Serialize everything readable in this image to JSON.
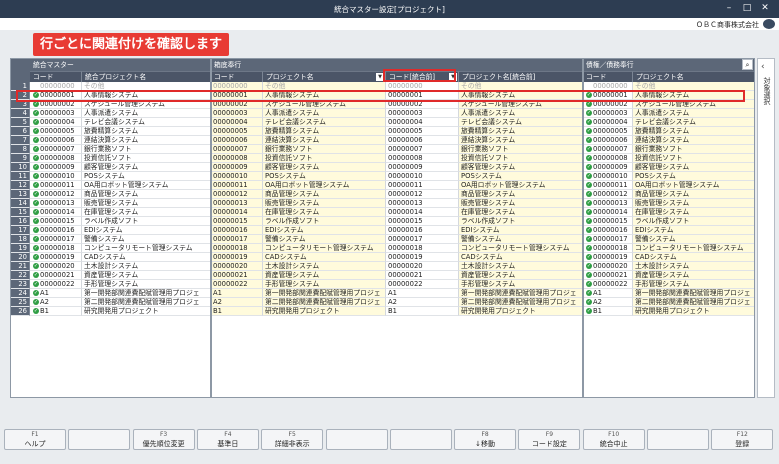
{
  "window": {
    "title": "統合マスター設定[プロジェクト]",
    "company": "ＯＢＣ商事株式会社"
  },
  "notice": "行ごとに関連付けを確認します",
  "groups": {
    "merged": "統合マスター",
    "left": "箱底奉行",
    "right": "債権／債務奉行"
  },
  "headers": {
    "code": "コード",
    "merged_name": "統合プロジェクト名",
    "project_name": "プロジェクト名",
    "code_merged": "コード[統合前]",
    "name_merged": "プロジェクト名[統合前]"
  },
  "side_panel": {
    "label": "対象選択"
  },
  "rows": [
    {
      "n": "1",
      "code": "00000000",
      "name": "その他",
      "lc": "00000000",
      "ln": "その他",
      "mc": "00000000",
      "mn": "その他",
      "rc": "00000000",
      "rn": "その他",
      "check": false,
      "placeholder": true
    },
    {
      "n": "2",
      "code": "00000001",
      "name": "人事情報システム",
      "lc": "00000001",
      "ln": "人事情報システム",
      "mc": "00000001",
      "mn": "人事情報システム",
      "rc": "00000001",
      "rn": "人事情報システム",
      "check": true
    },
    {
      "n": "3",
      "code": "00000002",
      "name": "スケジュール管理システム",
      "lc": "00000002",
      "ln": "スケジュール管理システム",
      "mc": "00000002",
      "mn": "スケジュール管理システム",
      "rc": "00000002",
      "rn": "スケジュール管理システム",
      "check": true
    },
    {
      "n": "4",
      "code": "00000003",
      "name": "人事派遣システム",
      "lc": "00000003",
      "ln": "人事派遣システム",
      "mc": "00000003",
      "mn": "人事派遣システム",
      "rc": "00000003",
      "rn": "人事派遣システム",
      "check": true
    },
    {
      "n": "5",
      "code": "00000004",
      "name": "テレビ会議システム",
      "lc": "00000004",
      "ln": "テレビ会議システム",
      "mc": "00000004",
      "mn": "テレビ会議システム",
      "rc": "00000004",
      "rn": "テレビ会議システム",
      "check": true
    },
    {
      "n": "6",
      "code": "00000005",
      "name": "旅費精算システム",
      "lc": "00000005",
      "ln": "旅費精算システム",
      "mc": "00000005",
      "mn": "旅費精算システム",
      "rc": "00000005",
      "rn": "旅費精算システム",
      "check": true
    },
    {
      "n": "7",
      "code": "00000006",
      "name": "連結決算システム",
      "lc": "00000006",
      "ln": "連結決算システム",
      "mc": "00000006",
      "mn": "連結決算システム",
      "rc": "00000006",
      "rn": "連結決算システム",
      "check": true
    },
    {
      "n": "8",
      "code": "00000007",
      "name": "銀行業務ソフト",
      "lc": "00000007",
      "ln": "銀行業務ソフト",
      "mc": "00000007",
      "mn": "銀行業務ソフト",
      "rc": "00000007",
      "rn": "銀行業務ソフト",
      "check": true
    },
    {
      "n": "9",
      "code": "00000008",
      "name": "投資信託ソフト",
      "lc": "00000008",
      "ln": "投資信託ソフト",
      "mc": "00000008",
      "mn": "投資信託ソフト",
      "rc": "00000008",
      "rn": "投資信託ソフト",
      "check": true
    },
    {
      "n": "10",
      "code": "00000009",
      "name": "顧客管理システム",
      "lc": "00000009",
      "ln": "顧客管理システム",
      "mc": "00000009",
      "mn": "顧客管理システム",
      "rc": "00000009",
      "rn": "顧客管理システム",
      "check": true
    },
    {
      "n": "11",
      "code": "00000010",
      "name": "POSシステム",
      "lc": "00000010",
      "ln": "POSシステム",
      "mc": "00000010",
      "mn": "POSシステム",
      "rc": "00000010",
      "rn": "POSシステム",
      "check": true
    },
    {
      "n": "12",
      "code": "00000011",
      "name": "OA用ロボット管理システム",
      "lc": "00000011",
      "ln": "OA用ロボット管理システム",
      "mc": "00000011",
      "mn": "OA用ロボット管理システム",
      "rc": "00000011",
      "rn": "OA用ロボット管理システム",
      "check": true
    },
    {
      "n": "13",
      "code": "00000012",
      "name": "商品管理システム",
      "lc": "00000012",
      "ln": "商品管理システム",
      "mc": "00000012",
      "mn": "商品管理システム",
      "rc": "00000012",
      "rn": "商品管理システム",
      "check": true
    },
    {
      "n": "14",
      "code": "00000013",
      "name": "販売管理システム",
      "lc": "00000013",
      "ln": "販売管理システム",
      "mc": "00000013",
      "mn": "販売管理システム",
      "rc": "00000013",
      "rn": "販売管理システム",
      "check": true
    },
    {
      "n": "15",
      "code": "00000014",
      "name": "在庫管理システム",
      "lc": "00000014",
      "ln": "在庫管理システム",
      "mc": "00000014",
      "mn": "在庫管理システム",
      "rc": "00000014",
      "rn": "在庫管理システム",
      "check": true
    },
    {
      "n": "16",
      "code": "00000015",
      "name": "ラベル作成ソフト",
      "lc": "00000015",
      "ln": "ラベル作成ソフト",
      "mc": "00000015",
      "mn": "ラベル作成ソフト",
      "rc": "00000015",
      "rn": "ラベル作成ソフト",
      "check": true
    },
    {
      "n": "17",
      "code": "00000016",
      "name": "EDIシステム",
      "lc": "00000016",
      "ln": "EDIシステム",
      "mc": "00000016",
      "mn": "EDIシステム",
      "rc": "00000016",
      "rn": "EDIシステム",
      "check": true
    },
    {
      "n": "18",
      "code": "00000017",
      "name": "警備システム",
      "lc": "00000017",
      "ln": "警備システム",
      "mc": "00000017",
      "mn": "警備システム",
      "rc": "00000017",
      "rn": "警備システム",
      "check": true
    },
    {
      "n": "19",
      "code": "00000018",
      "name": "コンピュータリモート管理システム",
      "lc": "00000018",
      "ln": "コンピュータリモート管理システム",
      "mc": "00000018",
      "mn": "コンピュータリモート管理システム",
      "rc": "00000018",
      "rn": "コンピュータリモート管理システム",
      "check": true
    },
    {
      "n": "20",
      "code": "00000019",
      "name": "CADシステム",
      "lc": "00000019",
      "ln": "CADシステム",
      "mc": "00000019",
      "mn": "CADシステム",
      "rc": "00000019",
      "rn": "CADシステム",
      "check": true
    },
    {
      "n": "21",
      "code": "00000020",
      "name": "土木設計システム",
      "lc": "00000020",
      "ln": "土木設計システム",
      "mc": "00000020",
      "mn": "土木設計システム",
      "rc": "00000020",
      "rn": "土木設計システム",
      "check": true
    },
    {
      "n": "22",
      "code": "00000021",
      "name": "資産管理システム",
      "lc": "00000021",
      "ln": "資産管理システム",
      "mc": "00000021",
      "mn": "資産管理システム",
      "rc": "00000021",
      "rn": "資産管理システム",
      "check": true
    },
    {
      "n": "23",
      "code": "00000022",
      "name": "手形管理システム",
      "lc": "00000022",
      "ln": "手形管理システム",
      "mc": "00000022",
      "mn": "手形管理システム",
      "rc": "00000022",
      "rn": "手形管理システム",
      "check": true
    },
    {
      "n": "24",
      "code": "A1",
      "name": "第一開発部関連費配賦管理用プロジェ",
      "lc": "A1",
      "ln": "第一開発部関連費配賦管理用プロジェ",
      "mc": "A1",
      "mn": "第一開発部関連費配賦管理用プロジェ",
      "rc": "A1",
      "rn": "第一開発部関連費配賦管理用プロジェ",
      "check": true
    },
    {
      "n": "25",
      "code": "A2",
      "name": "第二開発部関連費配賦管理用プロジェ",
      "lc": "A2",
      "ln": "第二開発部関連費配賦管理用プロジェ",
      "mc": "A2",
      "mn": "第二開発部関連費配賦管理用プロジェ",
      "rc": "A2",
      "rn": "第二開発部関連費配賦管理用プロジェ",
      "check": true
    },
    {
      "n": "26",
      "code": "B1",
      "name": "研究開発用プロジェクト",
      "lc": "B1",
      "ln": "研究開発用プロジェクト",
      "mc": "B1",
      "mn": "研究開発用プロジェクト",
      "rc": "B1",
      "rn": "研究開発用プロジェクト",
      "check": true
    }
  ],
  "fkeys": [
    {
      "key": "F1",
      "label": "ヘルプ"
    },
    {
      "key": "",
      "label": ""
    },
    {
      "key": "F3",
      "label": "優先順位変更"
    },
    {
      "key": "F4",
      "label": "基準日"
    },
    {
      "key": "F5",
      "label": "詳細非表示"
    },
    {
      "key": "",
      "label": ""
    },
    {
      "key": "",
      "label": ""
    },
    {
      "key": "F8",
      "label": "↓移動"
    },
    {
      "key": "F9",
      "label": "コード設定"
    },
    {
      "key": "F10",
      "label": "統合中止"
    },
    {
      "key": "",
      "label": ""
    },
    {
      "key": "F12",
      "label": "登録"
    }
  ]
}
